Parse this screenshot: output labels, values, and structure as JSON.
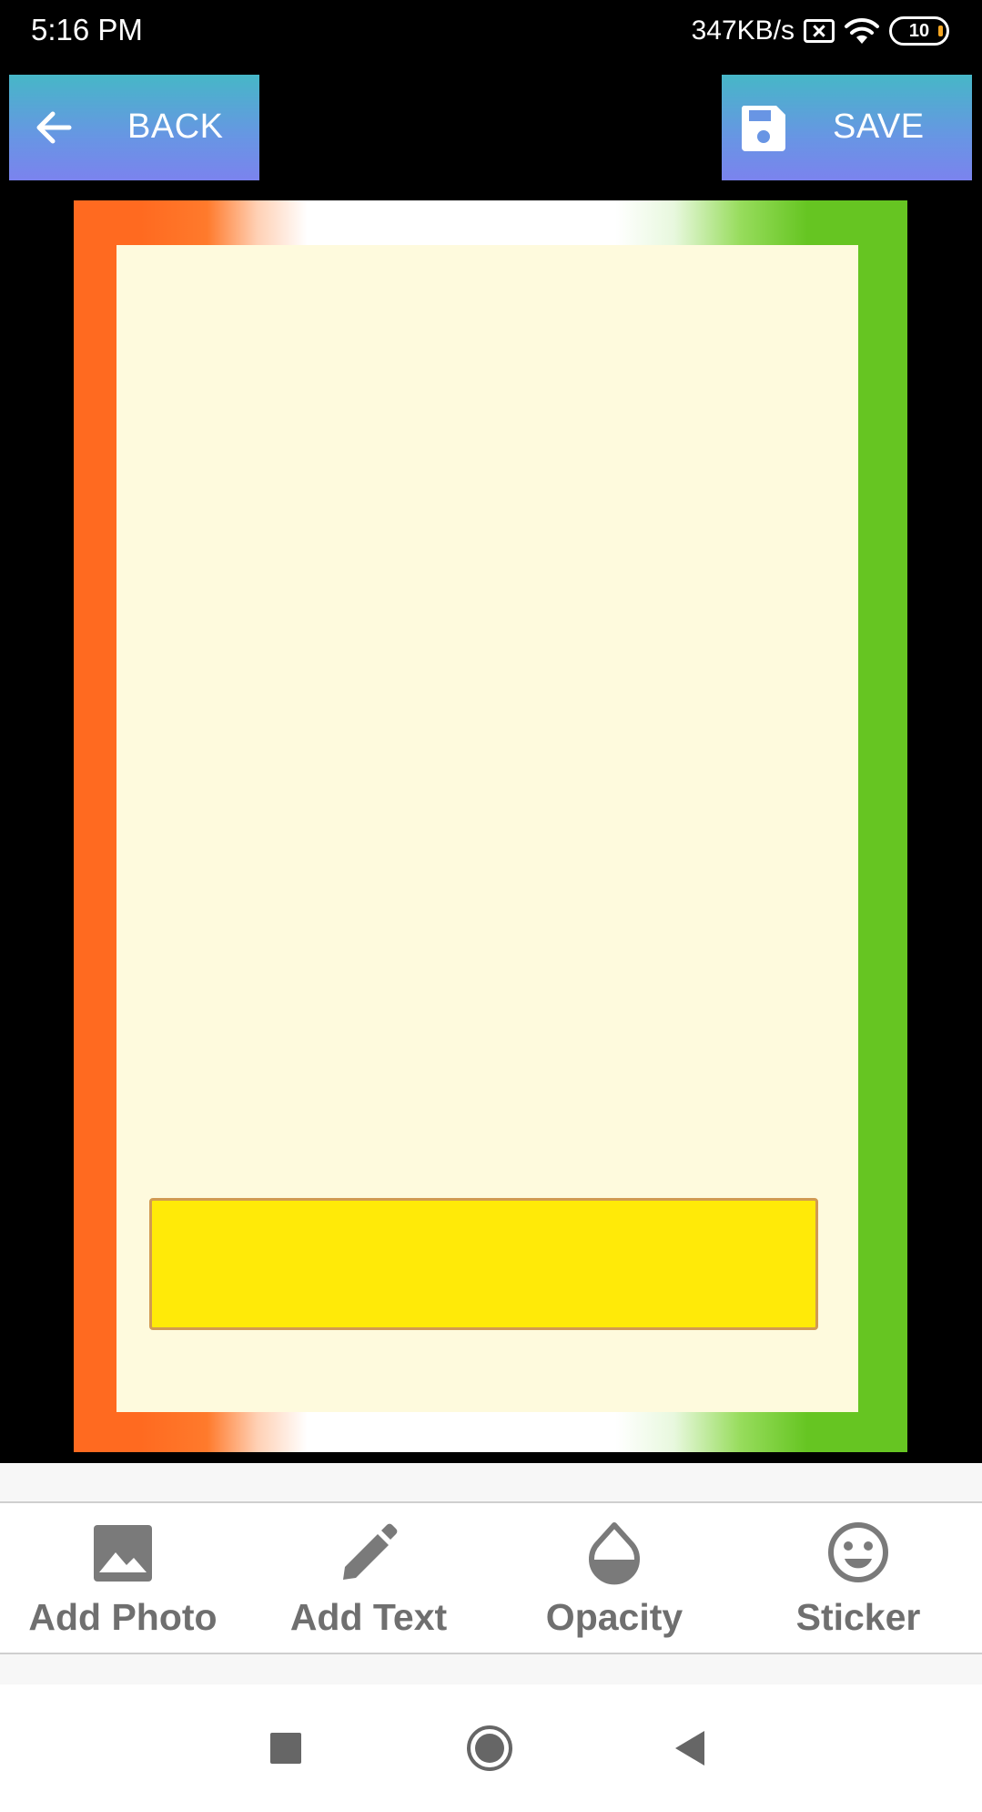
{
  "status_bar": {
    "time": "5:16 PM",
    "net_speed": "347KB/s",
    "battery": "10"
  },
  "header": {
    "back_label": "BACK",
    "save_label": "SAVE"
  },
  "toolbar": {
    "items": [
      {
        "label": "Add Photo",
        "icon": "image-icon"
      },
      {
        "label": "Add Text",
        "icon": "pencil-icon"
      },
      {
        "label": "Opacity",
        "icon": "opacity-drop-icon"
      },
      {
        "label": "Sticker",
        "icon": "smiley-icon"
      }
    ]
  },
  "colors": {
    "button_gradient_top": "#46b7c7",
    "button_gradient_bottom": "#7b83ee",
    "frame_saffron": "#ff6a20",
    "frame_green": "#66c522",
    "panel_cream": "#fefadd",
    "text_box_yellow": "#ffea08"
  }
}
